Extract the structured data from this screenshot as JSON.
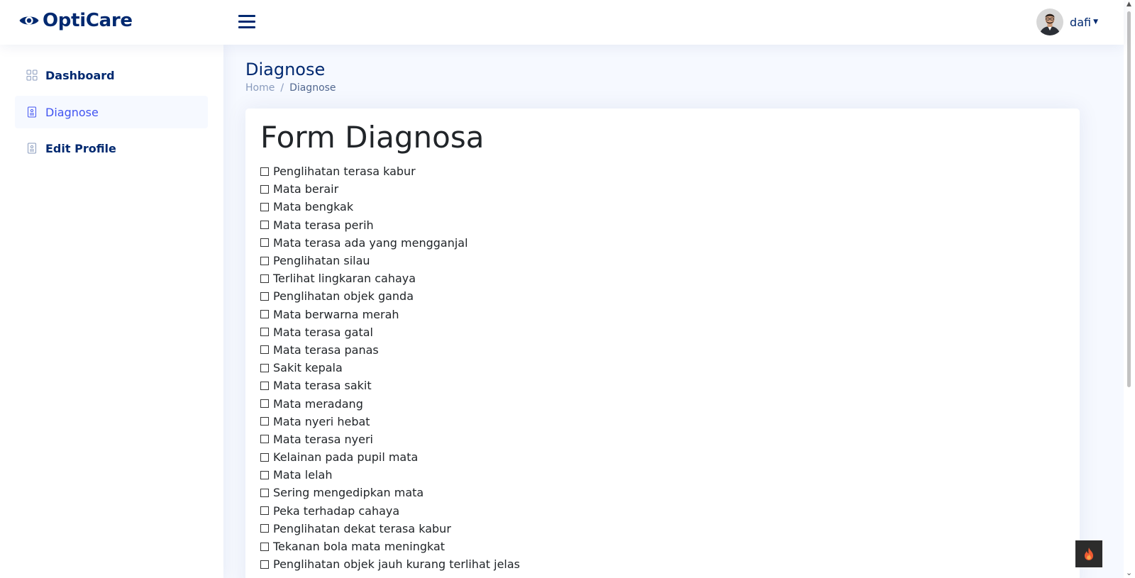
{
  "app": {
    "name": "OptiCare"
  },
  "header": {
    "user_name": "dafi"
  },
  "sidebar": {
    "items": [
      {
        "label": "Dashboard",
        "active": false
      },
      {
        "label": "Diagnose",
        "active": true
      },
      {
        "label": "Edit Profile",
        "active": false
      }
    ]
  },
  "page": {
    "title": "Diagnose",
    "breadcrumb": {
      "home": "Home",
      "separator": "/",
      "current": "Diagnose"
    }
  },
  "form": {
    "title": "Form Diagnosa",
    "symptoms": [
      "Penglihatan terasa kabur",
      "Mata berair",
      "Mata bengkak",
      "Mata terasa perih",
      "Mata terasa ada yang mengganjal",
      "Penglihatan silau",
      "Terlihat lingkaran cahaya",
      "Penglihatan objek ganda",
      "Mata berwarna merah",
      "Mata terasa gatal",
      "Mata terasa panas",
      "Sakit kepala",
      "Mata terasa sakit",
      "Mata meradang",
      "Mata nyeri hebat",
      "Mata terasa nyeri",
      "Kelainan pada pupil mata",
      "Mata lelah",
      "Sering mengedipkan mata",
      "Peka terhadap cahaya",
      "Penglihatan dekat terasa kabur",
      "Tekanan bola mata meningkat",
      "Penglihatan objek jauh kurang terlihat jelas"
    ]
  },
  "colors": {
    "primary": "#012970",
    "accent": "#4154f1",
    "background": "#f6f9ff",
    "text": "#212529"
  },
  "icons": {
    "logo": "eye-icon",
    "menu": "hamburger-icon",
    "dashboard": "grid-icon",
    "diagnose": "document-icon",
    "edit_profile": "document-icon",
    "back_to_top": "flame-icon"
  }
}
